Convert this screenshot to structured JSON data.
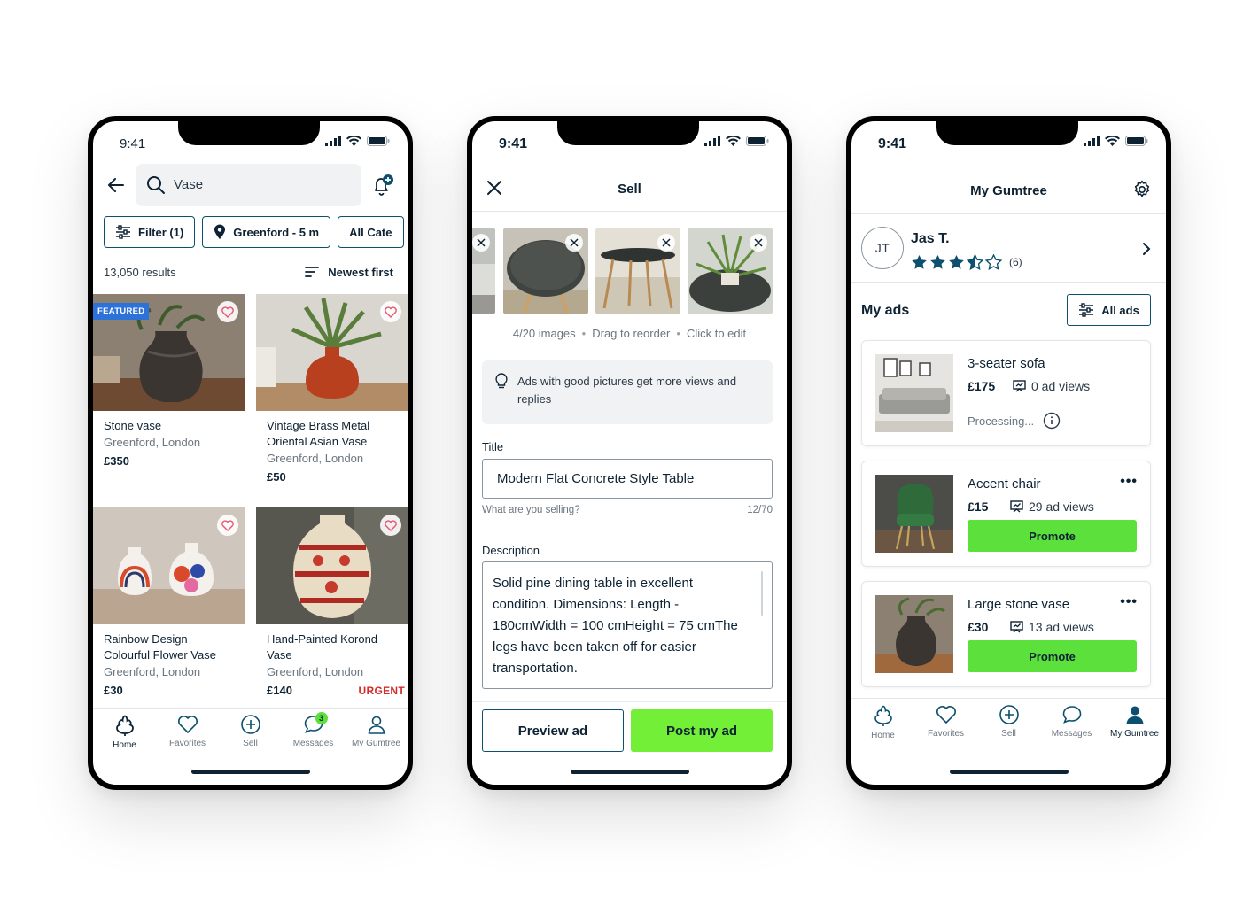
{
  "colors": {
    "brand_dark": "#0d2233",
    "accent_green": "#5ce03b",
    "urgent_red": "#d42b2b",
    "featured_blue": "#2d72d9"
  },
  "phone1": {
    "time": "9:41",
    "search": {
      "value": "Vase"
    },
    "chips": [
      {
        "label": "Filter (1)",
        "icon": "sliders-icon"
      },
      {
        "label": "Greenford - 5 m",
        "icon": "location-pin-icon"
      },
      {
        "label": "All Cate",
        "icon": ""
      }
    ],
    "results_count": "13,050 results",
    "sort_label": "Newest first",
    "listings": [
      {
        "title": "Stone vase",
        "location": "Greenford, London",
        "price": "£350",
        "badge": "FEATURED",
        "tag": ""
      },
      {
        "title": "Vintage Brass Metal Oriental Asian Vase",
        "location": "Greenford, London",
        "price": "£50",
        "badge": "",
        "tag": ""
      },
      {
        "title": "Rainbow Design Colourful Flower Vase",
        "location": "Greenford, London",
        "price": "£30",
        "badge": "",
        "tag": ""
      },
      {
        "title": "Hand-Painted Korond Vase",
        "location": "Greenford, London",
        "price": "£140",
        "badge": "",
        "tag": "URGENT"
      }
    ],
    "tabs": [
      {
        "label": "Home",
        "icon": "home-tree-icon",
        "active": true
      },
      {
        "label": "Favorites",
        "icon": "heart-icon"
      },
      {
        "label": "Sell",
        "icon": "plus-circle-icon"
      },
      {
        "label": "Messages",
        "icon": "chat-bubble-icon",
        "badge": "3"
      },
      {
        "label": "My Gumtree",
        "icon": "person-icon"
      }
    ]
  },
  "phone2": {
    "time": "9:41",
    "title": "Sell",
    "image_meta": {
      "count": "4/20 images",
      "reorder": "Drag to reorder",
      "edit": "Click to edit"
    },
    "tip": "Ads with good pictures get more views and replies",
    "title_field": {
      "label": "Title",
      "value": "Modern Flat Concrete Style Table",
      "help": "What are you selling?",
      "counter": "12/70"
    },
    "description": {
      "label": "Description",
      "value": "Solid pine dining table in excellent condition. Dimensions: Length - 180cmWidth = 100 cmHeight = 75 cmThe legs have been taken off for easier transportation."
    },
    "buttons": {
      "preview": "Preview ad",
      "post": "Post my ad"
    }
  },
  "phone3": {
    "time": "9:41",
    "title": "My Gumtree",
    "profile": {
      "initials": "JT",
      "name": "Jas T.",
      "rating": 3.5,
      "rating_count": "(6)"
    },
    "my_ads_title": "My ads",
    "all_ads_label": "All ads",
    "ads": [
      {
        "title": "3-seater sofa",
        "price": "£175",
        "views": "0 ad views",
        "status": "Processing...",
        "action": ""
      },
      {
        "title": "Accent chair",
        "price": "£15",
        "views": "29 ad views",
        "status": "",
        "action": "Promote"
      },
      {
        "title": "Large stone vase",
        "price": "£30",
        "views": "13 ad views",
        "status": "",
        "action": "Promote"
      }
    ],
    "tabs": [
      {
        "label": "Home",
        "icon": "home-tree-icon"
      },
      {
        "label": "Favorites",
        "icon": "heart-icon"
      },
      {
        "label": "Sell",
        "icon": "plus-circle-icon"
      },
      {
        "label": "Messages",
        "icon": "chat-bubble-icon"
      },
      {
        "label": "My Gumtree",
        "icon": "person-filled-icon",
        "active": true
      }
    ]
  }
}
